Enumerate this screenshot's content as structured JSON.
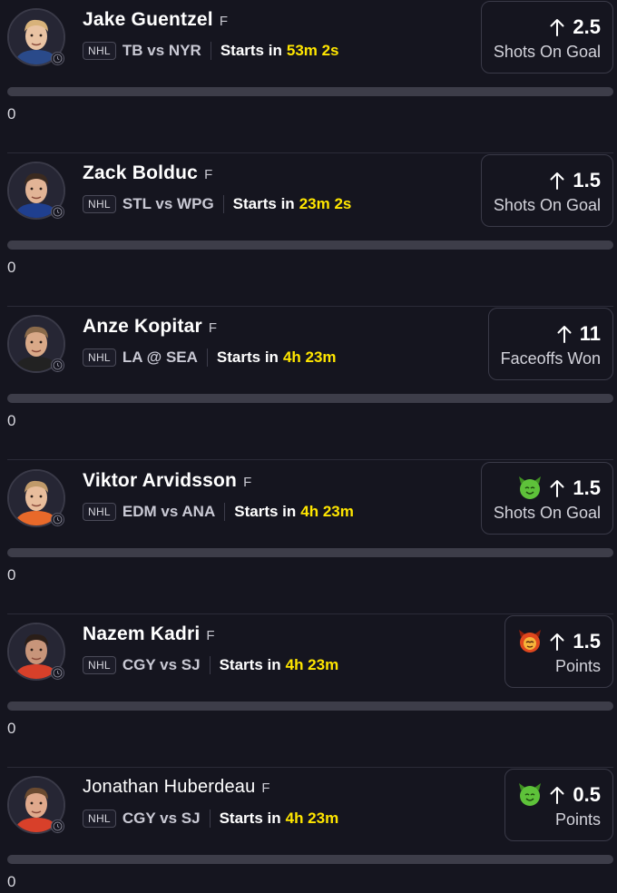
{
  "players": [
    {
      "name": "Jake Guentzel",
      "position": "F",
      "league": "NHL",
      "matchup": "TB vs NYR",
      "starts_label": "Starts in",
      "countdown": "53m 2s",
      "line": "2.5",
      "stat": "Shots On Goal",
      "emoji": "",
      "progress_value": "0",
      "progress_fraction": 0,
      "skin": "#e9c3a3",
      "hair": "#d8b27a",
      "jersey": "#2a4a8a"
    },
    {
      "name": "Zack Bolduc",
      "position": "F",
      "league": "NHL",
      "matchup": "STL vs WPG",
      "starts_label": "Starts in",
      "countdown": "23m 2s",
      "line": "1.5",
      "stat": "Shots On Goal",
      "emoji": "",
      "progress_value": "0",
      "progress_fraction": 0,
      "skin": "#e2b496",
      "hair": "#3a2a20",
      "jersey": "#1f3f8f"
    },
    {
      "name": "Anze Kopitar",
      "position": "F",
      "league": "NHL",
      "matchup": "LA @ SEA",
      "starts_label": "Starts in",
      "countdown": "4h 23m",
      "line": "11",
      "stat": "Faceoffs Won",
      "emoji": "",
      "progress_value": "0",
      "progress_fraction": 0,
      "skin": "#d9a988",
      "hair": "#8a6a4a",
      "jersey": "#222222"
    },
    {
      "name": "Viktor Arvidsson",
      "position": "F",
      "league": "NHL",
      "matchup": "EDM vs ANA",
      "starts_label": "Starts in",
      "countdown": "4h 23m",
      "line": "1.5",
      "stat": "Shots On Goal",
      "emoji": "green-devil",
      "progress_value": "0",
      "progress_fraction": 0,
      "skin": "#e8bd9c",
      "hair": "#c09a6a",
      "jersey": "#e8692a"
    },
    {
      "name": "Nazem Kadri",
      "position": "F",
      "league": "NHL",
      "matchup": "CGY vs SJ",
      "starts_label": "Starts in",
      "countdown": "4h 23m",
      "line": "1.5",
      "stat": "Points",
      "emoji": "red-devil",
      "progress_value": "0",
      "progress_fraction": 0,
      "skin": "#c8957a",
      "hair": "#2a1e18",
      "jersey": "#d8402a"
    },
    {
      "name": "Jonathan Huberdeau",
      "position": "F",
      "league": "NHL",
      "matchup": "CGY vs SJ",
      "starts_label": "Starts in",
      "countdown": "4h 23m",
      "line": "0.5",
      "stat": "Points",
      "emoji": "green-devil",
      "progress_value": "0",
      "progress_fraction": 0,
      "skin": "#e0a98c",
      "hair": "#6a4a30",
      "jersey": "#d8402a"
    }
  ],
  "colors": {
    "countdown": "#ffe600",
    "background": "#15151f",
    "green_devil": "#5ec23a",
    "red_devil": "#e0481e"
  }
}
